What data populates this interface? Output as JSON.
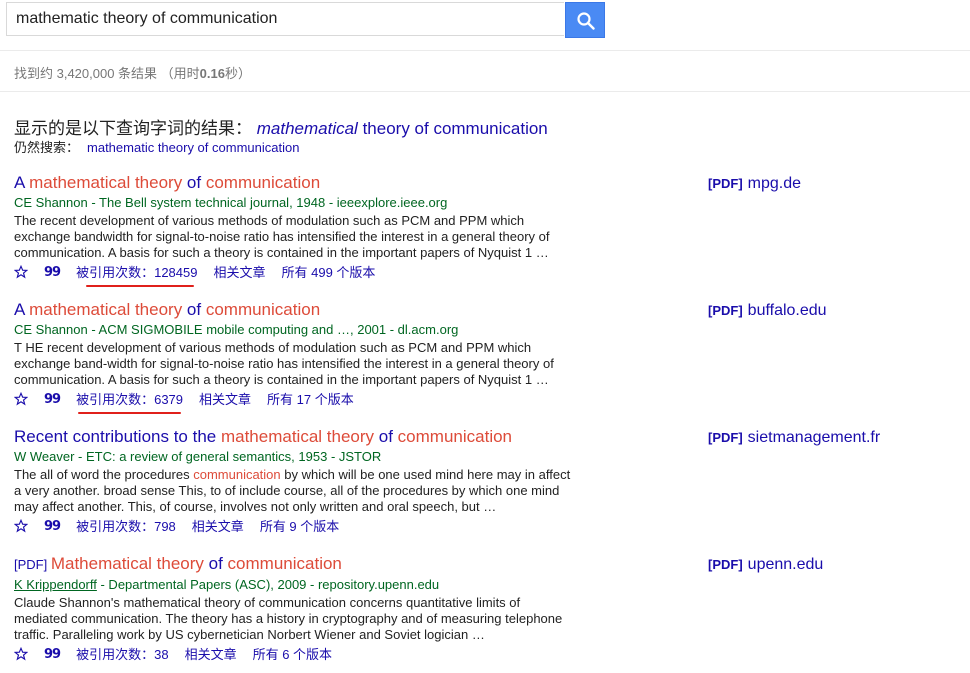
{
  "search": {
    "value": "mathematic theory of communication"
  },
  "stats": {
    "prefix": "找到约 3,420,000 条结果 （用时",
    "time": "0.16",
    "suffix": "秒）"
  },
  "correction": {
    "label": "显示的是以下查询字词的结果：",
    "corrected_italic": "mathematical",
    "corrected_rest": " theory of communication",
    "still_label": "仍然搜索：",
    "original_query": "mathematic theory of communication"
  },
  "results": [
    {
      "title_prefix": "A ",
      "title_hl1": "mathematical theory",
      "title_mid": " of ",
      "title_hl2": "communication",
      "meta": "CE Shannon - The Bell system technical journal, 1948 - ieeexplore.ieee.org",
      "snippet": "The recent development of various methods of modulation such as PCM and PPM which exchange bandwidth for signal-to-noise ratio has intensified the interest in a general theory of communication. A basis for such a theory is contained in the important papers of Nyquist 1 …",
      "cited": "被引用次数：128459",
      "related": "相关文章",
      "versions": "所有 499 个版本",
      "side_pdf": "[PDF]",
      "side_domain": "mpg.de"
    },
    {
      "title_prefix": "A ",
      "title_hl1": "mathematical theory",
      "title_mid": " of ",
      "title_hl2": "communication",
      "meta": "CE Shannon - ACM SIGMOBILE mobile computing and …, 2001 - dl.acm.org",
      "snippet": "T HE recent development of various methods of modulation such as PCM and PPM which exchange band-width for signal-to-noise ratio has intensified the interest in a general theory of communication. A basis for such a theory is contained in the important papers of Nyquist 1 …",
      "cited": "被引用次数：6379",
      "related": "相关文章",
      "versions": "所有 17 个版本",
      "side_pdf": "[PDF]",
      "side_domain": "buffalo.edu"
    },
    {
      "title_prefix": "Recent contributions to the ",
      "title_hl1": "mathematical theory",
      "title_mid": " of ",
      "title_hl2": "communication",
      "meta": "W Weaver - ETC: a review of general semantics, 1953 - JSTOR",
      "snippet_a": "The all of word the procedures ",
      "snippet_hl": "communication",
      "snippet_b": " by which will be one used mind here may in affect a very another. broad sense This, to of include course, all of the procedures by which one mind may affect another. This, of course, involves not only written and oral speech, but …",
      "cited": "被引用次数：798",
      "related": "相关文章",
      "versions": "所有 9 个版本",
      "side_pdf": "[PDF]",
      "side_domain": "sietmanagement.fr"
    },
    {
      "pdf_tag": "[PDF] ",
      "title_hl1": "Mathematical theory",
      "title_mid": " of ",
      "title_hl2": "communication",
      "meta_author": "K Krippendorff",
      "meta_rest": " - Departmental Papers (ASC), 2009 - repository.upenn.edu",
      "snippet": "Claude Shannon's mathematical theory of communication concerns quantitative limits of mediated communication. The theory has a history in cryptography and of measuring telephone traffic. Paralleling work by US cybernetician Norbert Wiener and Soviet logician …",
      "cited": "被引用次数：38",
      "related": "相关文章",
      "versions": "所有 6 个版本",
      "side_pdf": "[PDF]",
      "side_domain": "upenn.edu"
    }
  ],
  "icons": {
    "search_button": "search-icon",
    "save": "star-icon",
    "cite": "quote-icon"
  },
  "colors": {
    "link": "#1a0dab",
    "highlight": "#dd4b39",
    "meta_green": "#006621",
    "search_button": "#4a8af4",
    "annotation_underline": "#e0201b"
  }
}
